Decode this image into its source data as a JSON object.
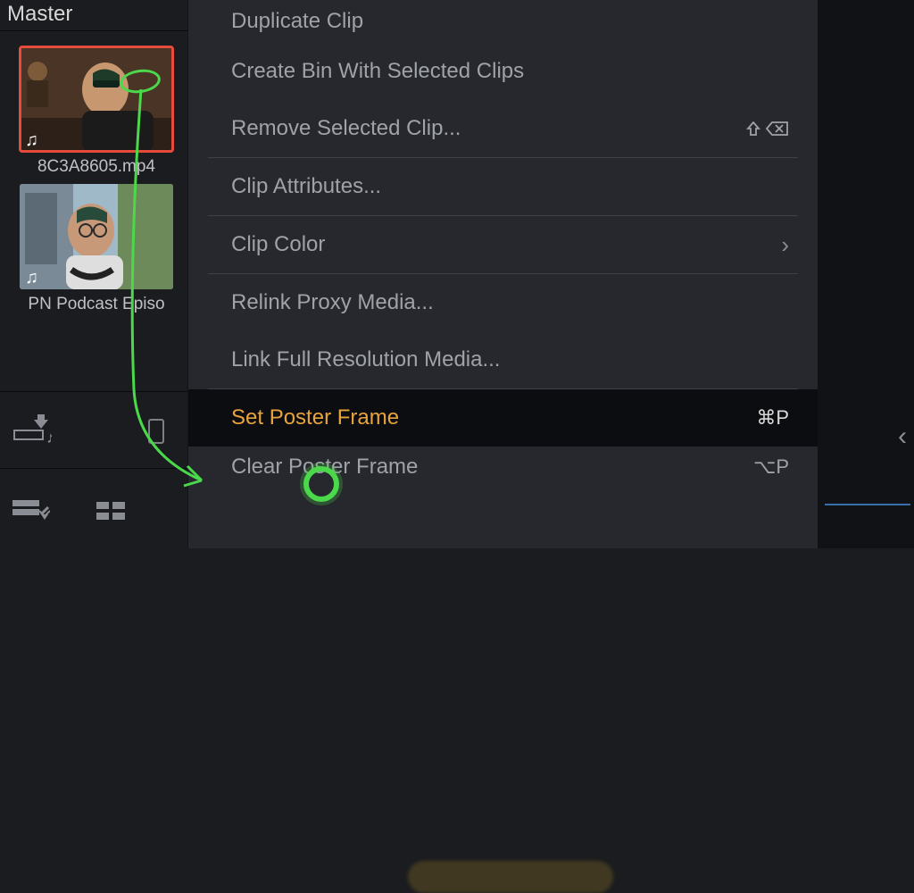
{
  "panel": {
    "title": "Master"
  },
  "clips": [
    {
      "label": "8C3A8605.mp4",
      "selected": true
    },
    {
      "label": "PN Podcast Episo",
      "selected": false
    }
  ],
  "menu": {
    "items": [
      {
        "label": "Duplicate Clip",
        "shortcut": "",
        "sep_after": false
      },
      {
        "label": "Create Bin With Selected Clips",
        "shortcut": "",
        "sep_after": false
      },
      {
        "label": "Remove Selected Clip...",
        "shortcut": "shift-delete",
        "sep_after": true
      },
      {
        "label": "Clip Attributes...",
        "shortcut": "",
        "sep_after": true
      },
      {
        "label": "Clip Color",
        "shortcut": "submenu",
        "sep_after": true
      },
      {
        "label": "Relink Proxy Media...",
        "shortcut": "",
        "sep_after": false
      },
      {
        "label": "Link Full Resolution Media...",
        "shortcut": "",
        "sep_after": true
      },
      {
        "label": "Set Poster Frame",
        "shortcut": "⌘P",
        "highlighted": true,
        "sep_after": false
      },
      {
        "label": "Clear Poster Frame",
        "shortcut": "⌥P",
        "sep_after": false
      }
    ]
  }
}
